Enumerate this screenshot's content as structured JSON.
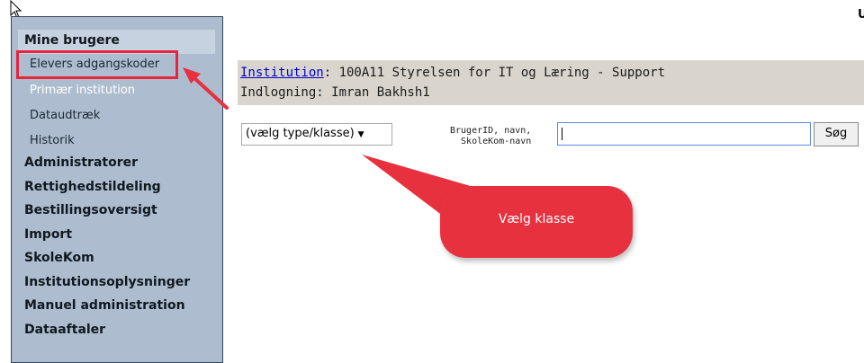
{
  "sidebar": {
    "header": "Mine brugere",
    "sub_items": [
      {
        "label": "Elevers adgangskoder"
      },
      {
        "label": "Primær institution"
      },
      {
        "label": "Dataudtræk"
      },
      {
        "label": "Historik"
      }
    ],
    "items": [
      {
        "label": "Administratorer"
      },
      {
        "label": "Rettighedstildeling"
      },
      {
        "label": "Bestillingsoversigt"
      },
      {
        "label": "Import"
      },
      {
        "label": "SkoleKom"
      },
      {
        "label": "Institutionsoplysninger"
      },
      {
        "label": "Manuel administration"
      },
      {
        "label": "Dataaftaler"
      }
    ]
  },
  "info": {
    "institution_link": "Institution",
    "institution_value": ": 100A11 Styrelsen for IT og Læring - Support",
    "login_line": "Indlogning: Imran Bakhsh1"
  },
  "filter": {
    "select_value": "(vælg type/klasse)",
    "select_arrow": "▼"
  },
  "search": {
    "label_line1": "BrugerID, navn,",
    "label_line2": "SkoleKom-navn",
    "input_value": "",
    "button_label": "Søg"
  },
  "annotation": {
    "callout_text": "Vælg klasse",
    "accent_color": "#e7313f"
  },
  "corner": {
    "text": "U"
  }
}
